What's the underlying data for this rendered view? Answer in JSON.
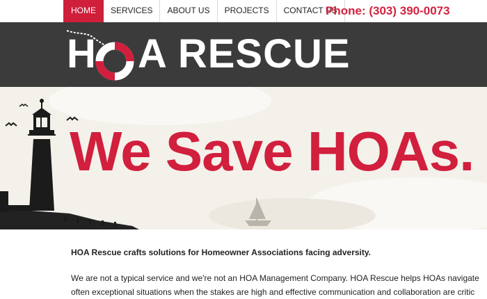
{
  "nav": {
    "items": [
      {
        "label": "HOME",
        "active": true
      },
      {
        "label": "SERVICES",
        "active": false
      },
      {
        "label": "ABOUT US",
        "active": false
      },
      {
        "label": "PROJECTS",
        "active": false
      },
      {
        "label": "CONTACT US",
        "active": false
      }
    ],
    "phone": "Phone: (303) 390-0073"
  },
  "header": {
    "logo_text": "HOA RESCUE",
    "logo_part1": "H",
    "logo_part2": "A RESCUE",
    "logo_icon": "life-ring-icon"
  },
  "hero": {
    "headline": "We Save HOAs."
  },
  "content": {
    "intro": "HOA Rescue crafts solutions for Homeowner Associations facing adversity.",
    "line1": "We are not a typical service and we're not an HOA Management Company. HOA Rescue helps HOAs navigate",
    "line2": "often exceptional situations when the stakes are high and effective communication and collaboration are critic"
  },
  "colors": {
    "brand_red": "#d11f3d",
    "header_bg": "#3b3b3b",
    "hero_bg": "#f4f1ea"
  }
}
